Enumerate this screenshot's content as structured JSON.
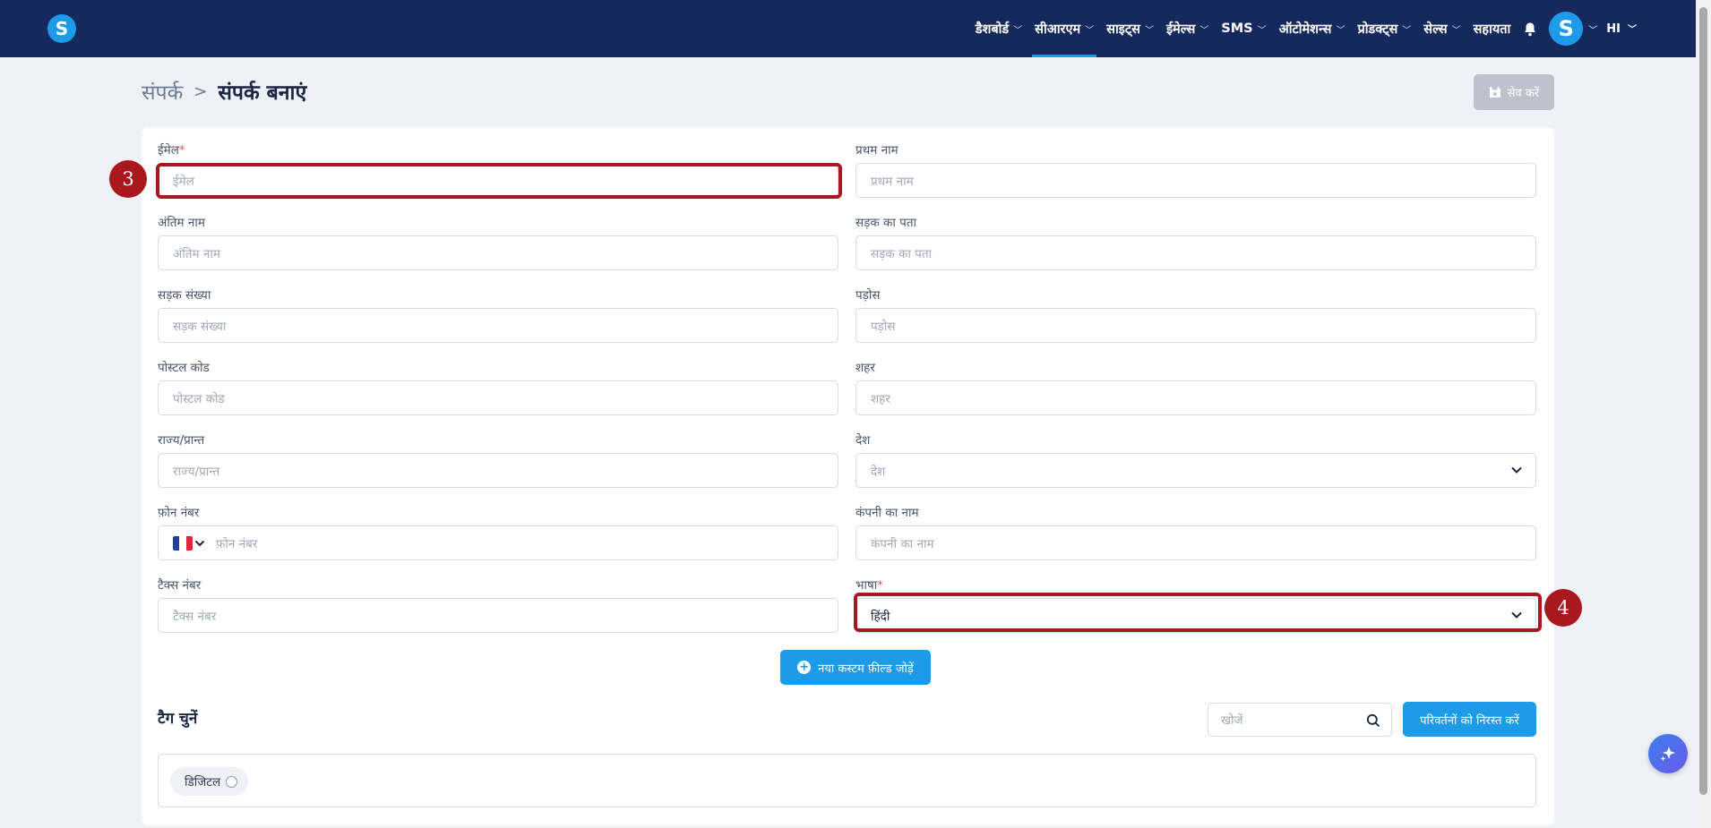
{
  "nav": {
    "logo_letter": "S",
    "items": [
      {
        "label": "डैशबोर्ड",
        "active": false
      },
      {
        "label": "सीआरएम",
        "active": true
      },
      {
        "label": "साइट्स",
        "active": false
      },
      {
        "label": "ईमेल्स",
        "active": false
      },
      {
        "label": "SMS",
        "active": false
      },
      {
        "label": "ऑटोमेशन्स",
        "active": false
      },
      {
        "label": "प्रोडक्ट्स",
        "active": false
      },
      {
        "label": "सेल्स",
        "active": false
      }
    ],
    "help_label": "सहायता",
    "avatar_letter": "S",
    "language": "HI"
  },
  "header": {
    "breadcrumb_parent": "संपर्क",
    "breadcrumb_current": "संपर्क बनाएं",
    "save_label": "सेव करें"
  },
  "form": {
    "email": {
      "label": "ईमेल",
      "required_mark": "*",
      "placeholder": "ईमेल"
    },
    "first_name": {
      "label": "प्रथम नाम",
      "placeholder": "प्रथम नाम"
    },
    "last_name": {
      "label": "अंतिम नाम",
      "placeholder": "अंतिम नाम"
    },
    "street_address": {
      "label": "सड़क का पता",
      "placeholder": "सड़क का पता"
    },
    "street_number": {
      "label": "सड़क संख्या",
      "placeholder": "सड़क संख्या"
    },
    "neighborhood": {
      "label": "पड़ोस",
      "placeholder": "पड़ोस"
    },
    "postal_code": {
      "label": "पोस्टल कोड",
      "placeholder": "पोस्टल कोड"
    },
    "city": {
      "label": "शहर",
      "placeholder": "शहर"
    },
    "state": {
      "label": "राज्य/प्रान्त",
      "placeholder": "राज्य/प्रान्त"
    },
    "country": {
      "label": "देश",
      "placeholder": "देश"
    },
    "phone": {
      "label": "फ़ोन नंबर",
      "placeholder": "फ़ोन नंबर",
      "flag_icon": "france-flag-icon"
    },
    "company": {
      "label": "कंपनी का नाम",
      "placeholder": "कंपनी का नाम"
    },
    "tax_number": {
      "label": "टैक्स नंबर",
      "placeholder": "टैक्स नंबर"
    },
    "language": {
      "label": "भाषा",
      "required_mark": "*",
      "value": "हिंदी"
    },
    "add_custom_field_label": "नया कस्टम फ़ील्ड जोड़ें"
  },
  "annotations": {
    "email_step": "3",
    "language_step": "4",
    "color": "#a8181e"
  },
  "tags": {
    "title": "टैग चुनें",
    "search_placeholder": "खोजें",
    "discard_label": "परिवर्तनों को निरस्त करें",
    "items": [
      {
        "label": "डिजिटल"
      }
    ]
  },
  "colors": {
    "nav_bg": "#16295e",
    "accent": "#1e9be8",
    "page_bg": "#eef2f7"
  }
}
